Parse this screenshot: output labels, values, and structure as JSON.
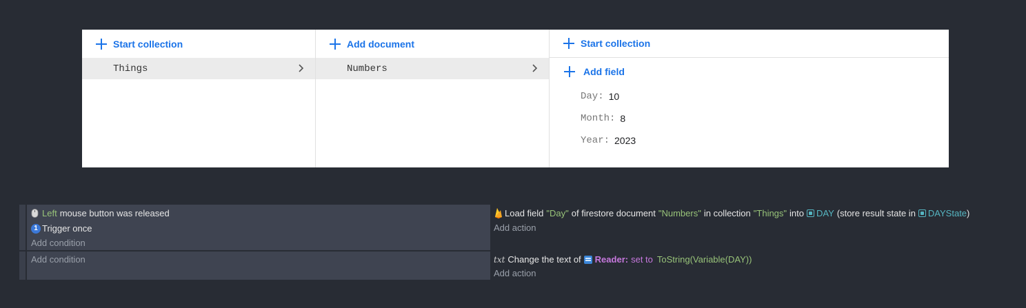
{
  "firestore": {
    "col1": {
      "header": "Start collection",
      "item": "Things"
    },
    "col2": {
      "header": "Add document",
      "item": "Numbers"
    },
    "col3": {
      "header": "Start collection",
      "add_field": "Add field",
      "fields": [
        {
          "key": "Day:",
          "value": "10"
        },
        {
          "key": "Month:",
          "value": "8"
        },
        {
          "key": "Year:",
          "value": "2023"
        }
      ]
    }
  },
  "events": {
    "e1": {
      "cond1": {
        "button": "Left",
        "text": "mouse button was released"
      },
      "cond2": "Trigger once",
      "add_condition": "Add condition",
      "action": {
        "p1": "Load field",
        "field": "\"Day\"",
        "p2": "of firestore document",
        "doc": "\"Numbers\"",
        "p3": "in collection",
        "coll": "\"Things\"",
        "p4": "into",
        "var": "DAY",
        "p5": "(store result state in",
        "state": "DAYState",
        "p6": ")"
      },
      "add_action": "Add action"
    },
    "e2": {
      "add_condition": "Add condition",
      "action": {
        "icon_text": "txt",
        "p1": "Change the text of",
        "obj": "Reader:",
        "p2": "set to",
        "expr": "ToString(Variable(DAY))"
      },
      "add_action": "Add action"
    }
  },
  "icons": {
    "plus": "plus-icon",
    "chevron": "chevron-right-icon",
    "mouse": "mouse-icon",
    "trigger": "trigger-once-icon",
    "firebase": "firebase-icon",
    "variable": "variable-icon",
    "text_object": "text-object-icon"
  },
  "colors": {
    "accent": "#1a73e8",
    "green": "#98c379",
    "blue": "#56b6c2",
    "purple": "#c678dd"
  }
}
